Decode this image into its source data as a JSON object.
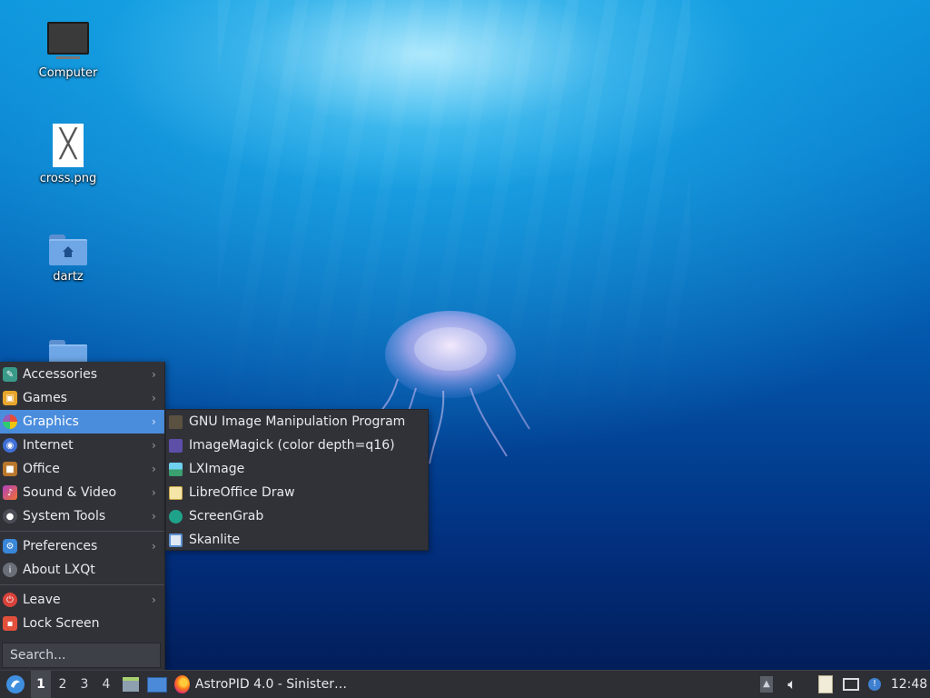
{
  "desktop": {
    "icons": [
      {
        "label": "Computer",
        "icon": "computer-icon"
      },
      {
        "label": "cross.png",
        "icon": "image-file-icon"
      },
      {
        "label": "dartz",
        "icon": "home-folder-icon"
      },
      {
        "label": "",
        "icon": "folder-icon"
      }
    ],
    "wallpaper": "jellyfish underwater"
  },
  "menu": {
    "items": [
      {
        "label": "Accessories",
        "icon": "accessories-icon",
        "submenu": true
      },
      {
        "label": "Games",
        "icon": "games-icon",
        "submenu": true
      },
      {
        "label": "Graphics",
        "icon": "graphics-icon",
        "submenu": true,
        "active": true
      },
      {
        "label": "Internet",
        "icon": "internet-icon",
        "submenu": true
      },
      {
        "label": "Office",
        "icon": "office-icon",
        "submenu": true
      },
      {
        "label": "Sound & Video",
        "icon": "sound-video-icon",
        "submenu": true
      },
      {
        "label": "System Tools",
        "icon": "system-tools-icon",
        "submenu": true
      }
    ],
    "settings_items": [
      {
        "label": "Preferences",
        "icon": "preferences-icon",
        "submenu": true
      },
      {
        "label": "About LXQt",
        "icon": "info-icon",
        "submenu": false
      }
    ],
    "session_items": [
      {
        "label": "Leave",
        "icon": "power-icon",
        "submenu": true
      },
      {
        "label": "Lock Screen",
        "icon": "lock-icon",
        "submenu": false
      }
    ],
    "search_placeholder": "Search...",
    "arrow": "›"
  },
  "graphics_submenu": {
    "items": [
      {
        "label": "GNU Image Manipulation Program",
        "icon": "gimp-icon"
      },
      {
        "label": "ImageMagick (color depth=q16)",
        "icon": "imagemagick-icon"
      },
      {
        "label": "LXImage",
        "icon": "lximage-icon"
      },
      {
        "label": "LibreOffice Draw",
        "icon": "libreoffice-draw-icon"
      },
      {
        "label": "ScreenGrab",
        "icon": "screengrab-icon"
      },
      {
        "label": "Skanlite",
        "icon": "skanlite-icon"
      }
    ]
  },
  "taskbar": {
    "workspaces": [
      "1",
      "2",
      "3",
      "4"
    ],
    "active_workspace": "1",
    "window_title": "AstroPID 4.0 - Sinister…",
    "clock": "12:48"
  },
  "colors": {
    "menu_bg": "#303238",
    "highlight": "#4b8ddd",
    "taskbar_bg": "#2d2f35"
  }
}
